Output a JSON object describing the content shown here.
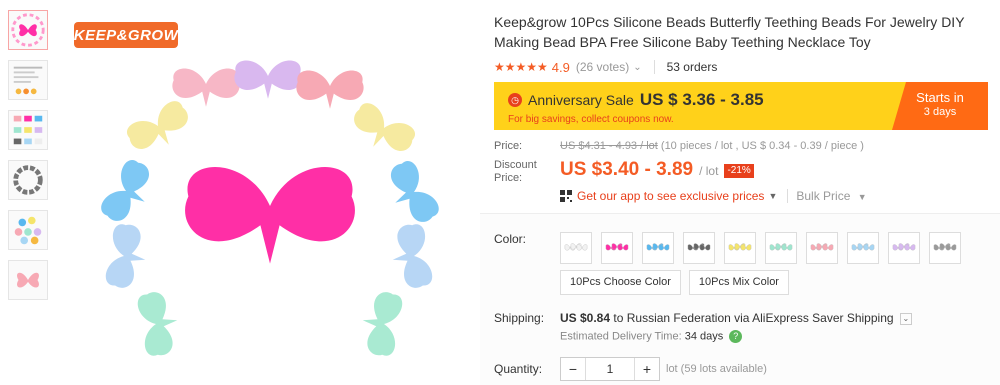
{
  "brand": {
    "logo_text": "KEEP&GROW"
  },
  "product": {
    "title": "Keep&grow 10Pcs Silicone Beads Butterfly Teething Beads For Jewelry DIY Making Bead BPA Free Silicone Baby Teething Necklace Toy",
    "stars": "★★★★★",
    "rating": "4.9",
    "votes": "(26 votes)",
    "orders": "53 orders"
  },
  "sale": {
    "label": "Anniversary Sale",
    "price": "US $ 3.36 - 3.85",
    "sub": "For big savings, collect coupons now.",
    "starts_label": "Starts in",
    "starts_value": "3 days",
    "colors": {
      "banner": "#ffd11a",
      "timer": "#ff6a14"
    }
  },
  "price": {
    "label": "Price:",
    "original": "US $4.31 - 4.93 / lot",
    "original_note": "(10 pieces / lot , US $ 0.34 - 0.39 / piece )",
    "discount_label": "Discount Price:",
    "discount": "US $3.40 - 3.89",
    "per_lot": "/ lot",
    "off_badge": "-21%",
    "app_link": "Get our app to see exclusive prices",
    "bulk": "Bulk Price"
  },
  "color": {
    "label": "Color:",
    "swatches": [
      {
        "name": "white",
        "hex": "#f2f2f2"
      },
      {
        "name": "rose",
        "hex": "#ff2fa6"
      },
      {
        "name": "sky-blue",
        "hex": "#58b8ef"
      },
      {
        "name": "dark-gray",
        "hex": "#666666"
      },
      {
        "name": "yellow",
        "hex": "#f5e56b"
      },
      {
        "name": "mint",
        "hex": "#9fe6cf"
      },
      {
        "name": "pink",
        "hex": "#f7a9b4"
      },
      {
        "name": "light-blue",
        "hex": "#a7d6f4"
      },
      {
        "name": "lavender",
        "hex": "#d7b9f0"
      },
      {
        "name": "gray",
        "hex": "#9a9a9a"
      }
    ],
    "options": [
      "10Pcs Choose Color",
      "10Pcs Mix Color"
    ]
  },
  "shipping": {
    "label": "Shipping:",
    "price": "US $0.84",
    "text": "to Russian Federation via AliExpress Saver Shipping",
    "delivery_label": "Estimated Delivery Time:",
    "delivery_days": "34 days"
  },
  "quantity": {
    "label": "Quantity:",
    "minus": "−",
    "value": "1",
    "plus": "+",
    "note": "lot (59 lots available)"
  },
  "icons": [
    "clock-icon",
    "qr-icon",
    "chevron-down-icon",
    "question-icon"
  ]
}
